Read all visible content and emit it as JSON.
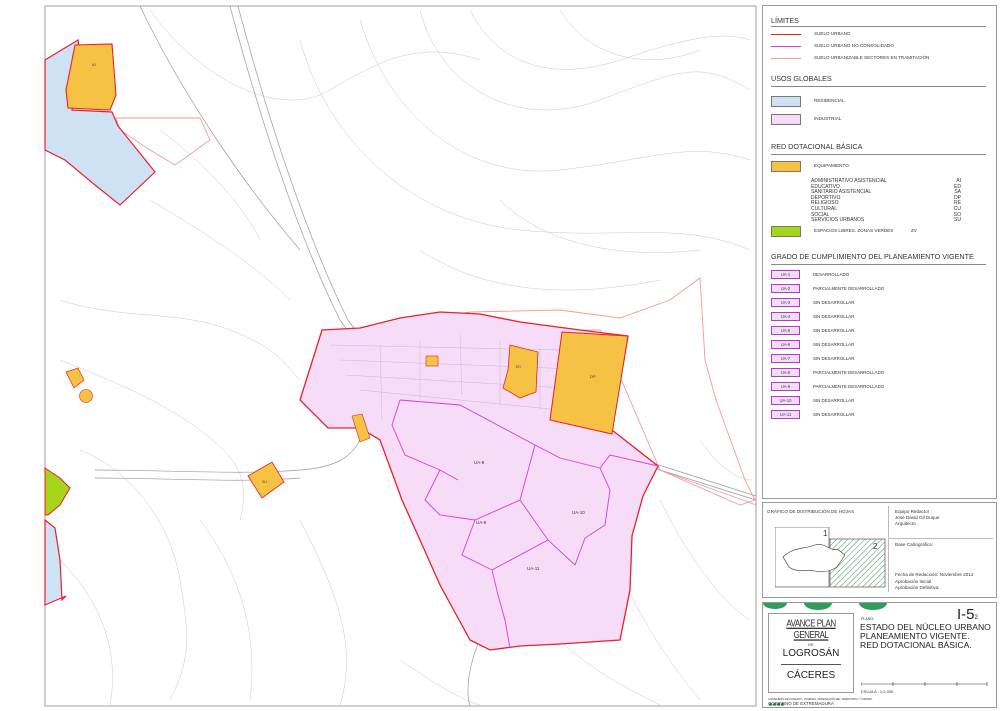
{
  "legend": {
    "limites": {
      "heading": "LÍMITES",
      "items": [
        {
          "label": "SUELO URBANO",
          "color": "#e8202a"
        },
        {
          "label": "SUELO URBANO NO CONSOLIDADO",
          "color": "#d23ee0"
        },
        {
          "label": "SUELO URBANIZABLE SECTORES EN TRAMITACIÓN",
          "color": "#f19b9b"
        }
      ]
    },
    "usos": {
      "heading": "USOS GLOBALES",
      "items": [
        {
          "label": "RESIDENCIAL",
          "color": "#cfe2f5"
        },
        {
          "label": "INDUSTRIAL",
          "color": "#f6dcf7"
        }
      ]
    },
    "red": {
      "heading": "RED DOTACIONAL BÁSICA",
      "equipamiento_label": "EQUIPAMIENTO",
      "equipamiento_color": "#f6c244",
      "types": [
        {
          "name": "ADMINISTRATIVO ASISTENCIAL",
          "code": "AI"
        },
        {
          "name": "EDUCATIVO",
          "code": "ED"
        },
        {
          "name": "SANITARIO ASISTENCIAL",
          "code": "SA"
        },
        {
          "name": "DEPORTIVO",
          "code": "DP"
        },
        {
          "name": "RELIGIOSO",
          "code": "RE"
        },
        {
          "name": "CULTURAL",
          "code": "CU"
        },
        {
          "name": "SOCIAL",
          "code": "SO"
        },
        {
          "name": "SERVICIOS URBANOS",
          "code": "SU"
        }
      ],
      "zonas_label": "ESPACIOS LIBRES. ZONAS VERDES",
      "zonas_code": "ZV",
      "zonas_color": "#a6d61c"
    },
    "grado": {
      "heading": "GRADO DE CUMPLIMIENTO DEL PLANEAMIENTO VIGENTE",
      "items": [
        {
          "code": "UA-1",
          "status": "DESARROLLADO"
        },
        {
          "code": "UA-2",
          "status": "PARCIALMENTE DESARROLLADO"
        },
        {
          "code": "UA-3",
          "status": "SIN DESARROLLAR"
        },
        {
          "code": "UA-4",
          "status": "SIN DESARROLLAR"
        },
        {
          "code": "UA-5",
          "status": "SIN DESARROLLAR"
        },
        {
          "code": "UA-6",
          "status": "SIN DESARROLLAR"
        },
        {
          "code": "UA-7",
          "status": "SIN DESARROLLAR"
        },
        {
          "code": "UA-8",
          "status": "PARCIALMENTE DESARROLLADO"
        },
        {
          "code": "UA-9",
          "status": "PARCIALMENTE DESARROLLADO"
        },
        {
          "code": "UA-10",
          "status": "SIN DESARROLLAR"
        },
        {
          "code": "UA-11",
          "status": "SIN DESARROLLAR"
        }
      ]
    }
  },
  "sheet": {
    "heading": "GRÁFICO DE DISTRIBUCIÓN DE HOJAS",
    "sheet1": "1",
    "sheet2": "2",
    "team_label": "Equipo Redactor :",
    "team_name": "José David Gil Duque",
    "team_role": "Arquitecto",
    "base_label": "Base Cartográfica:",
    "fecha": "Fecha de Redacción: Noviembre 2012",
    "aprob_inicial": "Aprobación Inicial",
    "aprob_definitiva": "Aprobación Definitiva"
  },
  "title_block": {
    "avance": "AVANCE PLAN GENERAL",
    "de": "DE",
    "town": "LOGROSÁN",
    "province": "CÁCERES",
    "plano_label": "PLANO:",
    "plano_number": "I-5",
    "plano_sub": "2",
    "plano_title_1": "ESTADO DEL NÚCLEO URBANO",
    "plano_title_2": "PLANEAMIENTO VIGENTE.",
    "plano_title_3": "RED DOTACIONAL BÁSICA.",
    "consejeria": "CONSEJERÍA DE FOMENTO, VIVIENDA, ORDENACIÓN DEL TERRITORIO Y TURISMO",
    "gobierno": "GOBIERNO DE EXTREMADURA",
    "escala": "ESCALA : 1:2.000"
  },
  "map_labels": {
    "ua8": "UA-8",
    "ua9": "UA-9",
    "ua10": "UA-10",
    "ua11": "UA-11"
  },
  "colors": {
    "suelo_urbano": "#e8202a",
    "no_consolidado": "#d23ee0",
    "urbanizable": "#f19b9b",
    "residencial": "#cfe2f5",
    "industrial": "#f6dcf7",
    "equipamiento": "#f6c244",
    "zona_verde": "#a6d61c",
    "sheet_hatch": "#3d8f5a"
  }
}
